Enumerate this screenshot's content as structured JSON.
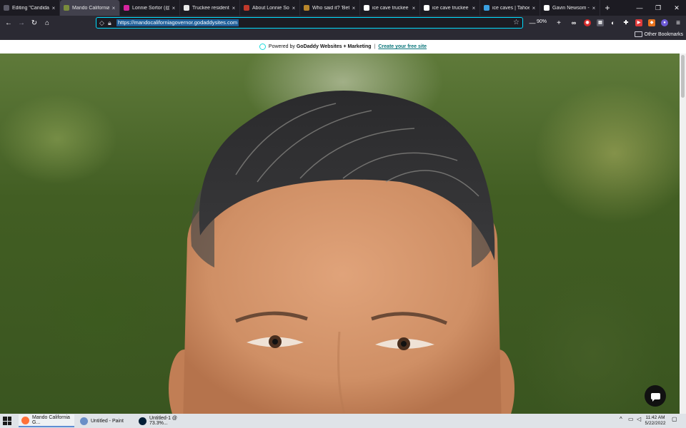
{
  "browser": {
    "tabs": [
      {
        "title": "Editing \"Candidates f",
        "favicon": "doc-icon",
        "color": "#5a5a66"
      },
      {
        "title": "Mando California Go",
        "favicon": "godaddy-icon",
        "color": "#7a8c3c",
        "active": true
      },
      {
        "title": "Lonnie Sortor (@lonn",
        "favicon": "instagram-icon",
        "color": "#d6249f"
      },
      {
        "title": "Truckee resident ente",
        "favicon": "news-icon",
        "color": "#e8e8e8"
      },
      {
        "title": "About Lonnie Sortor",
        "favicon": "shield-icon",
        "color": "#c0392b"
      },
      {
        "title": "Who said it? 'Better li",
        "favicon": "image-icon",
        "color": "#b8862b"
      },
      {
        "title": "ice cave truckee - Go",
        "favicon": "google-icon",
        "color": "#ffffff"
      },
      {
        "title": "ice cave truckee - Go",
        "favicon": "google-icon",
        "color": "#ffffff"
      },
      {
        "title": "ice caves | Tahoe Fals",
        "favicon": "globe-icon",
        "color": "#3aa0e0"
      },
      {
        "title": "Gavin Newsom - Wiki",
        "favicon": "wikipedia-icon",
        "color": "#ffffff"
      }
    ],
    "new_tab": "+",
    "window_controls": {
      "minimize": "—",
      "restore": "❐",
      "close": "✕"
    },
    "url": "https://mandocaliforniagovernor.godaddysites.com",
    "zoom": "90%",
    "zoom_out": "—",
    "zoom_in": "+",
    "bookmarks": {
      "other": "Other Bookmarks"
    }
  },
  "page": {
    "promo": {
      "powered_by": "Powered by",
      "brand": "GoDaddy Websites + Marketing",
      "separator": "|",
      "cta": "Create your free site"
    },
    "hero_image": "portrait-photo"
  },
  "taskbar": {
    "items": [
      {
        "label": "Mando California G...",
        "icon": "firefox-icon",
        "color": "#ff7139",
        "active": true
      },
      {
        "label": "Untitled - Paint",
        "icon": "paint-icon",
        "color": "#6a8fc7"
      },
      {
        "label": "Untitled-1 @ 73.3%...",
        "icon": "photoshop-icon",
        "color": "#001e36"
      }
    ],
    "time": "11:42 AM",
    "date": "5/22/2022"
  }
}
